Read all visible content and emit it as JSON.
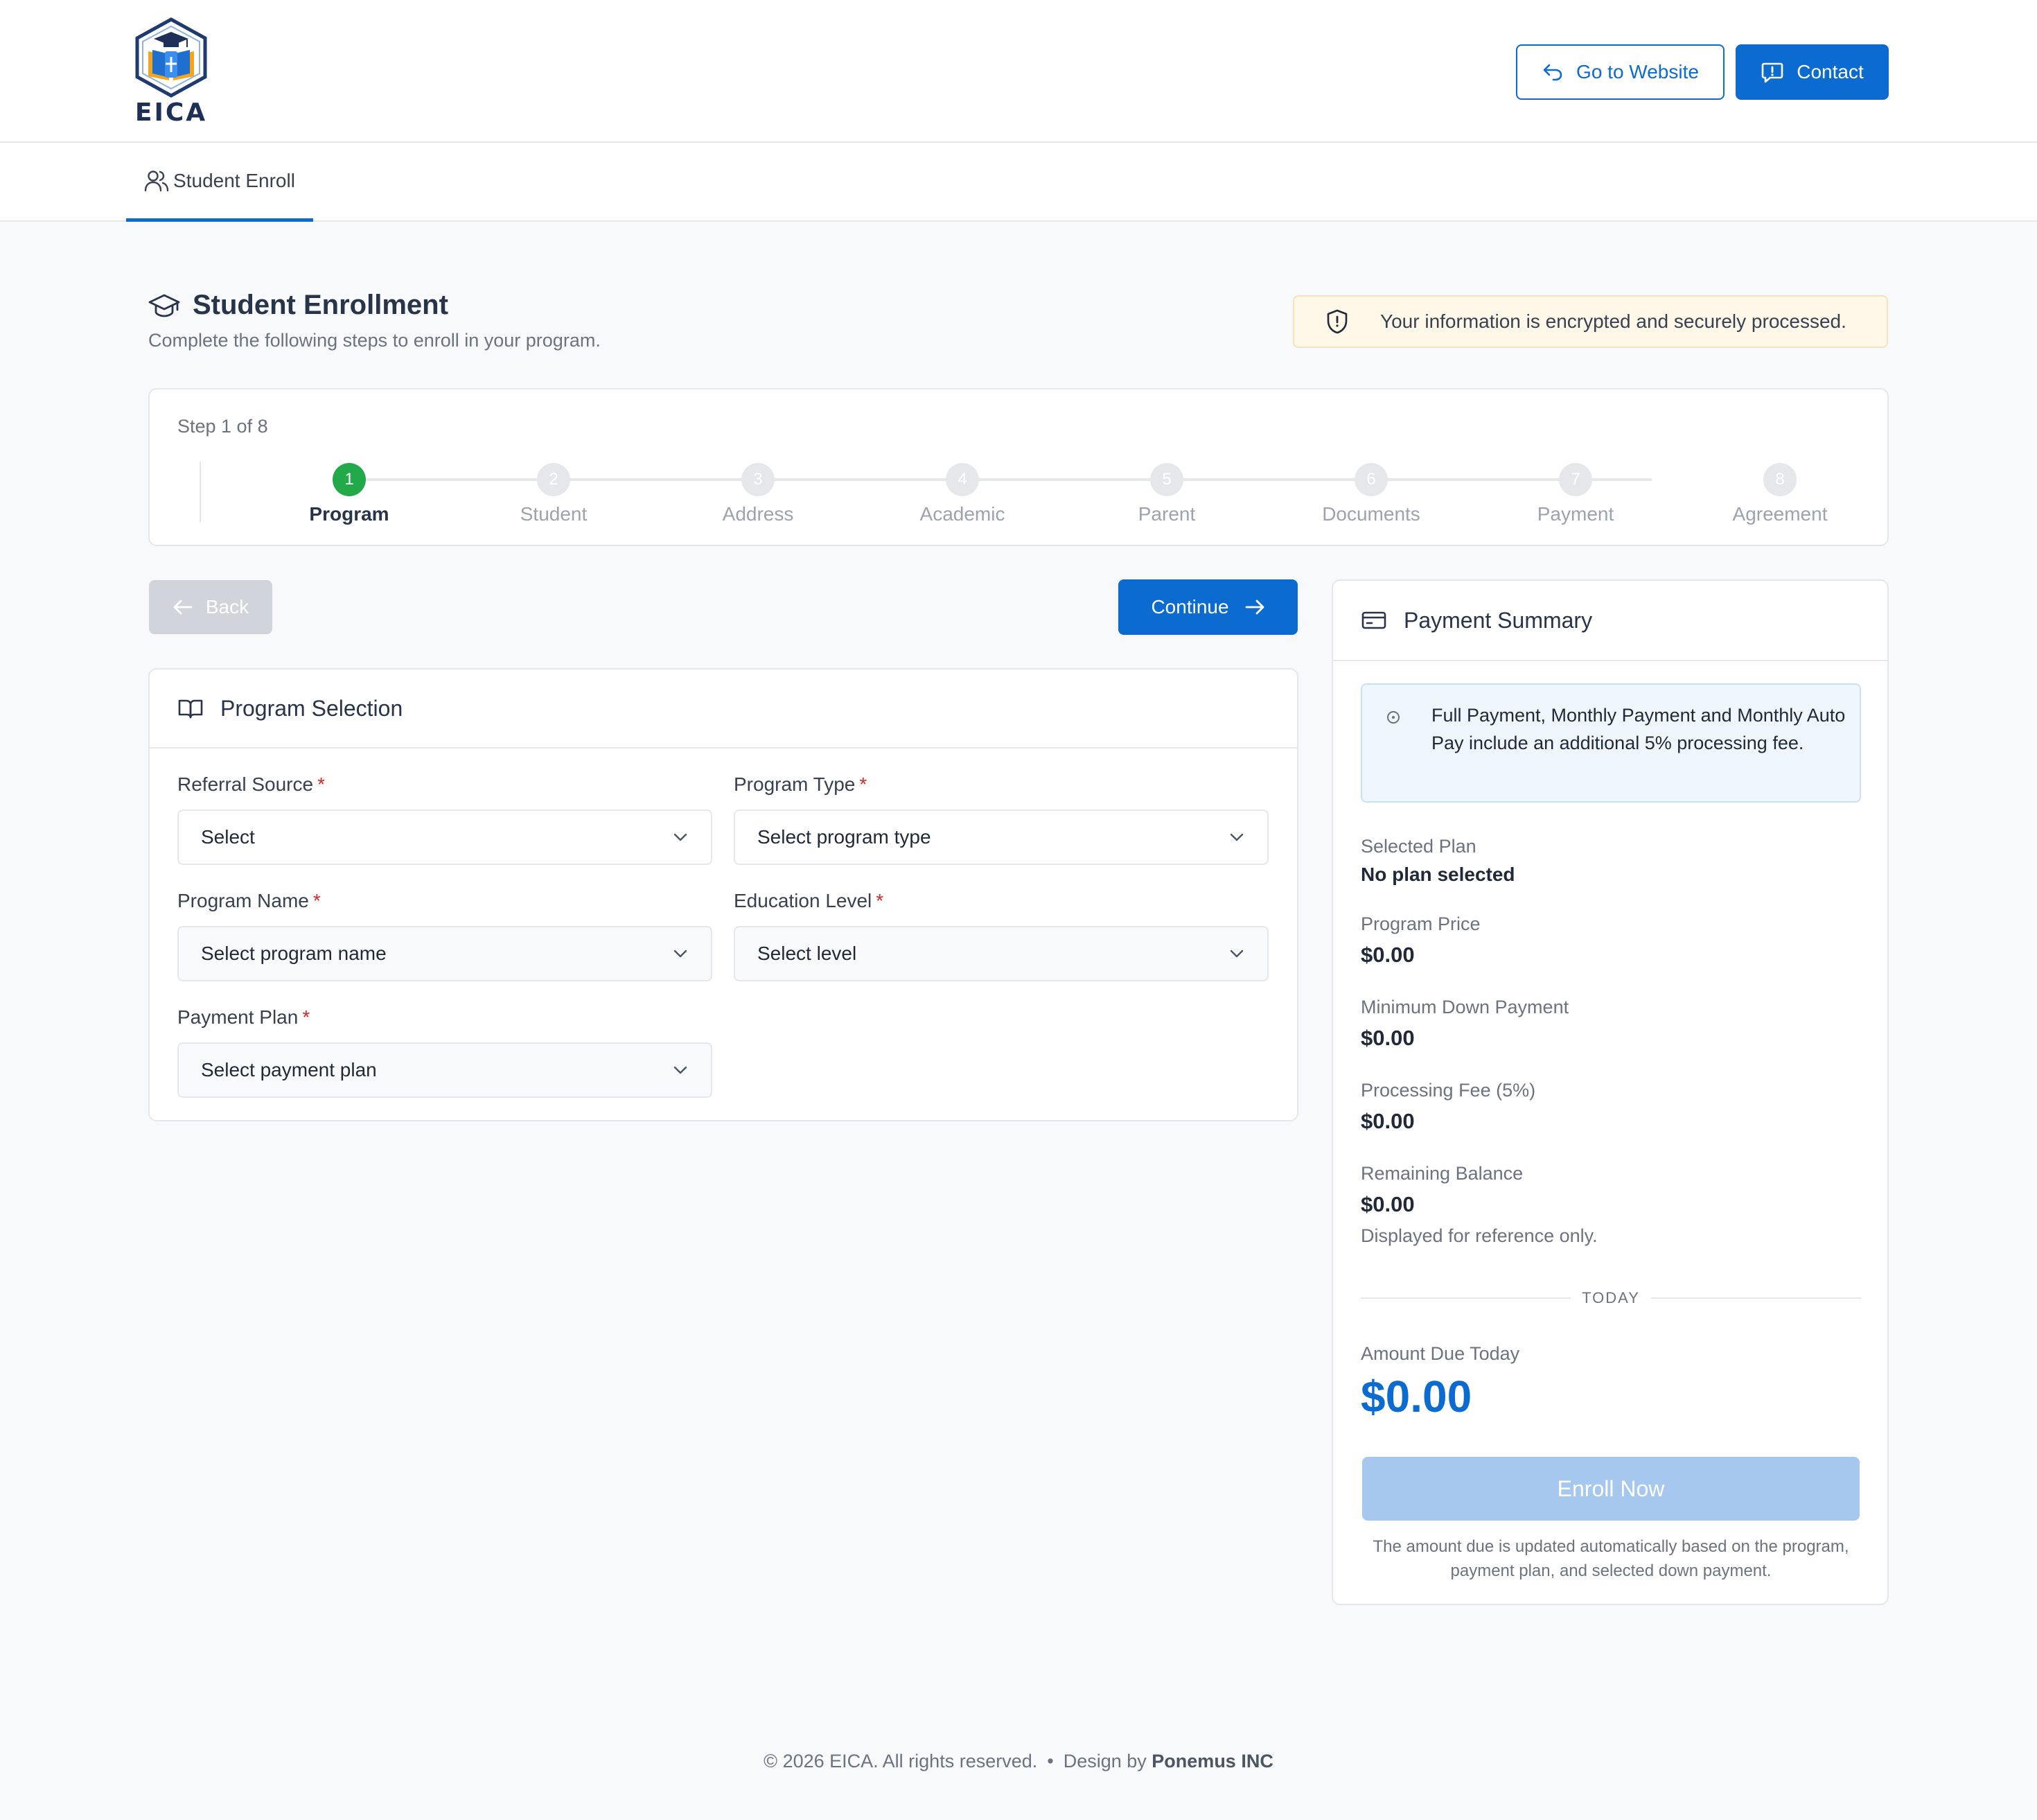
{
  "brand": {
    "name": "EICA"
  },
  "header": {
    "website_label": "Go to Website",
    "contact_label": "Contact"
  },
  "tabs": [
    {
      "label": "Student Enroll",
      "active": true
    }
  ],
  "page": {
    "title": "Student Enrollment",
    "subtitle": "Complete the following steps to enroll in your program.",
    "secure_note": "Your information is encrypted and securely processed."
  },
  "stepper": {
    "counter": "Step 1 of 8",
    "steps": [
      {
        "num": "1",
        "label": "Program",
        "active": true
      },
      {
        "num": "2",
        "label": "Student"
      },
      {
        "num": "3",
        "label": "Address"
      },
      {
        "num": "4",
        "label": "Academic"
      },
      {
        "num": "5",
        "label": "Parent"
      },
      {
        "num": "6",
        "label": "Documents"
      },
      {
        "num": "7",
        "label": "Payment"
      },
      {
        "num": "8",
        "label": "Agreement"
      }
    ]
  },
  "nav": {
    "back_label": "Back",
    "continue_label": "Continue"
  },
  "program_selection": {
    "title": "Program Selection",
    "required_mark": "*",
    "fields": {
      "referral_source": {
        "label": "Referral Source",
        "value": "Select"
      },
      "program_type": {
        "label": "Program Type",
        "value": "Select program type"
      },
      "program_name": {
        "label": "Program Name",
        "value": "Select program name"
      },
      "education_level": {
        "label": "Education Level",
        "value": "Select level"
      },
      "payment_plan": {
        "label": "Payment Plan",
        "value": "Select payment plan"
      }
    }
  },
  "payment_summary": {
    "title": "Payment Summary",
    "info": "Full Payment, Monthly Payment and Monthly Auto Pay include an additional 5% processing fee.",
    "selected_plan_label": "Selected Plan",
    "selected_plan_value": "No plan selected",
    "program_price_label": "Program Price",
    "program_price_value": "$0.00",
    "min_down_label": "Minimum Down Payment",
    "min_down_value": "$0.00",
    "processing_fee_label": "Processing Fee (5%)",
    "processing_fee_value": "$0.00",
    "remaining_label": "Remaining Balance",
    "remaining_value": "$0.00",
    "remaining_note": "Displayed for reference only.",
    "divider_label": "TODAY",
    "due_label": "Amount Due Today",
    "due_value": "$0.00",
    "enroll_label": "Enroll Now",
    "footnote": "The amount due is updated automatically based on the program, payment plan, and selected down payment."
  },
  "footer": {
    "copyright": "© 2026 EICA. All rights reserved.",
    "separator": "•",
    "design_prefix": "Design by",
    "design_by": "Ponemus INC"
  },
  "colors": {
    "primary": "#0b6bd1",
    "success": "#22a94a",
    "required": "#dc2626",
    "disabled_button": "#a6c8ef"
  }
}
